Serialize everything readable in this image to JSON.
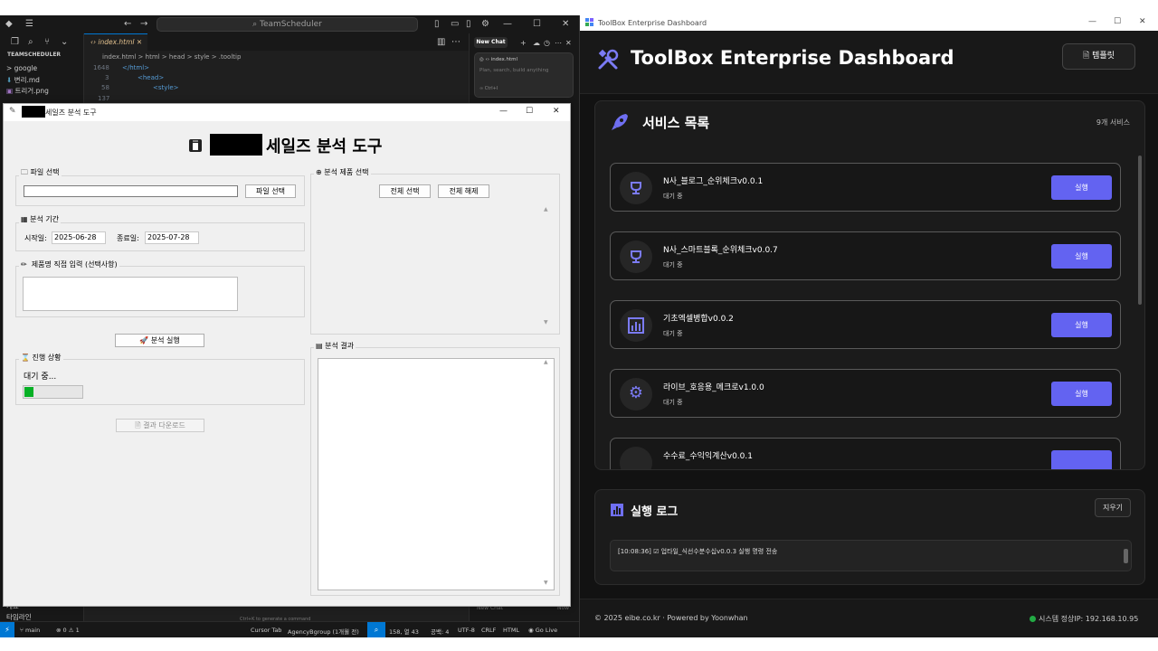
{
  "vscode": {
    "search_text": "TeamScheduler",
    "explorer_header": "TEAMSCHEDULER",
    "explorer_items": [
      "> google",
      "변리.md",
      "트리거.png"
    ],
    "tab_label": "index.html",
    "breadcrumb": "index.html > html > head > style > .tooltip",
    "line_numbers": [
      "1648",
      "3",
      "58",
      "137"
    ],
    "code_lines": [
      "</html>",
      "<head>",
      "<style>"
    ],
    "chat_button": "New Chat",
    "chat_file": "index.html",
    "chat_placeholder": "Plan, search, build anything",
    "chat_footer_left": "New Chat",
    "chat_footer_right": "Now",
    "hint": "Ctrl+K to generate a command",
    "bottom_rows": [
      "개요",
      "타임라인"
    ],
    "status": {
      "branch": "main",
      "problems": "⊗ 0 ⚠ 1",
      "cursor_tab": "Cursor Tab",
      "agency": "AgencyBgroup (1개월 전)",
      "position": "158, 열 43",
      "spaces": "공백: 4",
      "encoding": "UTF-8",
      "eol": "CRLF",
      "language": "HTML",
      "golive": "Go Live"
    }
  },
  "tk": {
    "title_suffix": "세일즈 분석 도구",
    "heading": "세일즈 분석 도구",
    "file_group": "파일 선택",
    "file_button": "파일 선택",
    "period_group": "분석 기간",
    "start_label": "시작일:",
    "start_value": "2025-06-28",
    "end_label": "종료일:",
    "end_value": "2025-07-28",
    "product_input_group": "제품명 직접 입력 (선택사항)",
    "run_button": "분석 실행",
    "progress_group": "진행 상황",
    "progress_text": "대기 중...",
    "progress_fraction": 0.16,
    "download_button": "결과 다운로드",
    "product_select_group": "분석 제품 선택",
    "select_all": "전체 선택",
    "deselect_all": "전체 해제",
    "result_group": "분석 결과"
  },
  "dash": {
    "window_title": "ToolBox Enterprise Dashboard",
    "app_title": "ToolBox Enterprise Dashboard",
    "template_button": "템플릿",
    "services_title": "서비스 목록",
    "services_count": "9개 서비스",
    "services": [
      {
        "name": "N사_블로그_순위체크v0.0.1",
        "status": "대기 중",
        "run": "실행",
        "icon": "trophy-icon"
      },
      {
        "name": "N사_스마트블록_순위체크v0.0.7",
        "status": "대기 중",
        "run": "실행",
        "icon": "trophy-icon"
      },
      {
        "name": "기초엑셀병합v0.0.2",
        "status": "대기 중",
        "run": "실행",
        "icon": "bar-chart-icon"
      },
      {
        "name": "라이브_호응용_메크로v1.0.0",
        "status": "대기 중",
        "run": "실행",
        "icon": "gear-icon"
      },
      {
        "name": "수수료_수익익계산v0.0.1",
        "status": "",
        "run": "",
        "icon": "gear-icon"
      }
    ],
    "log_title": "실행 로그",
    "clear_button": "지우기",
    "log_line": "[10:08:36] ☑ 업타일_식선수분수십v0.0.3 실행 명령 전송",
    "footer_left": "© 2025 eibe.co.kr  ·  Powered by Yoonwhan",
    "footer_right": "시스템 정상IP: 192.168.10.95",
    "accent": "#6363f1",
    "status_ok_color": "#22aa44"
  }
}
